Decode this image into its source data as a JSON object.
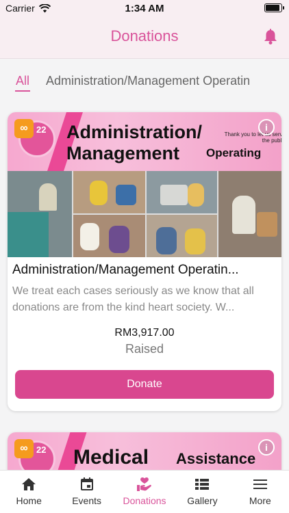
{
  "status": {
    "carrier": "Carrier",
    "time": "1:34 AM"
  },
  "header": {
    "title": "Donations"
  },
  "tabs": [
    {
      "label": "All",
      "active": true
    },
    {
      "label": "Administration/Management Operatin",
      "active": false
    }
  ],
  "cards": [
    {
      "banner": {
        "badge_icon": "infinity-icon",
        "logo_text": "22",
        "title_line1": "Administration/",
        "title_line2": "Management",
        "sub": "Operating",
        "note": "Thank you to let us serve the public"
      },
      "title": "Administration/Management Operatin...",
      "description": "We treat each cases seriously as we know that all donations are from the kind heart society. W...",
      "amount": "RM3,917.00",
      "raised_label": "Raised",
      "button": "Donate"
    },
    {
      "banner": {
        "badge_icon": "infinity-icon",
        "logo_text": "22",
        "title_line1": "Medical",
        "sub": "Assistance"
      }
    }
  ],
  "bottom_nav": [
    {
      "label": "Home",
      "icon": "home-icon",
      "active": false
    },
    {
      "label": "Events",
      "icon": "calendar-icon",
      "active": false
    },
    {
      "label": "Donations",
      "icon": "donation-heart-icon",
      "active": true
    },
    {
      "label": "Gallery",
      "icon": "gallery-list-icon",
      "active": false
    },
    {
      "label": "More",
      "icon": "menu-icon",
      "active": false
    }
  ],
  "colors": {
    "accent": "#d9539a",
    "button": "#d9478f",
    "badge": "#f59b1e"
  }
}
